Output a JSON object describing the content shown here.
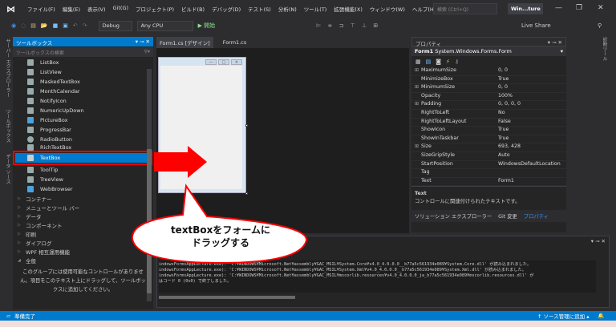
{
  "titlebar": {
    "menu": [
      "ファイル(F)",
      "編集(E)",
      "表示(V)",
      "Git(G)",
      "プロジェクト(P)",
      "ビルド(B)",
      "デバッグ(D)",
      "テスト(S)",
      "分析(N)",
      "ツール(T)",
      "拡張機能(X)",
      "ウィンドウ(W)",
      "ヘルプ(H)"
    ],
    "search_placeholder": "検索 (Ctrl+Q)",
    "window_title": "Win...ture"
  },
  "toolbar": {
    "config": "Debug",
    "platform": "Any CPU",
    "start": "▶ 開始",
    "live_share": "Live Share"
  },
  "left_strip": [
    "サーバー エクスプローラー",
    "ツールボックス",
    "データ ソース"
  ],
  "right_strip": "診断ツール",
  "toolbox": {
    "title": "ツールボックス",
    "search_placeholder": "ツールボックスの検索",
    "items": [
      "ListBox",
      "ListView",
      "MaskedTextBox",
      "MonthCalendar",
      "NotifyIcon",
      "NumericUpDown",
      "PictureBox",
      "ProgressBar",
      "RadioButton",
      "RichTextBox",
      "TextBox",
      "ToolTip",
      "TreeView",
      "WebBrowser"
    ],
    "selected": "TextBox",
    "groups": [
      "コンテナー",
      "メニューとツール バー",
      "データ",
      "コンポーネント",
      "印刷",
      "ダイアログ",
      "WPF 相互運用機能",
      "全般"
    ],
    "empty_note": "このグループには使用可能なコントロールがありません。項目をこのテキスト上にドラッグして、ツールボックスに追加してください。"
  },
  "doc_tabs": [
    "Form1.cs [デザイン]",
    "Form1.cs"
  ],
  "properties": {
    "title": "プロパティ",
    "object": "Form1",
    "object_type": "System.Windows.Forms.Form",
    "rows": [
      {
        "k": "MaximumSize",
        "v": "0, 0",
        "ex": true
      },
      {
        "k": "MinimizeBox",
        "v": "True"
      },
      {
        "k": "MinimumSize",
        "v": "0, 0",
        "ex": true
      },
      {
        "k": "Opacity",
        "v": "100%"
      },
      {
        "k": "Padding",
        "v": "0, 0, 0, 0",
        "ex": true
      },
      {
        "k": "RightToLeft",
        "v": "No"
      },
      {
        "k": "RightToLeftLayout",
        "v": "False"
      },
      {
        "k": "ShowIcon",
        "v": "True"
      },
      {
        "k": "ShowInTaskbar",
        "v": "True"
      },
      {
        "k": "Size",
        "v": "693, 428",
        "ex": true
      },
      {
        "k": "SizeGripStyle",
        "v": "Auto"
      },
      {
        "k": "StartPosition",
        "v": "WindowsDefaultLocation"
      },
      {
        "k": "Tag",
        "v": ""
      },
      {
        "k": "Text",
        "v": "Form1"
      }
    ],
    "desc_title": "Text",
    "desc": "コントロールに関連付けられたテキストです。",
    "bottom_tabs": [
      "ソリューション エクスプローラー",
      "Git 変更",
      "プロパティ"
    ]
  },
  "output": {
    "lines": [
      "indowsFormsAppLecture.exe): 'C:¥WINDOWS¥Microsoft.Net¥assembly¥GAC_MSIL¥System.Core¥v4.0_4.0.0.0__b77a5c561934e089¥System.Core.dll' が読み込まれました。",
      "indowsFormsAppLecture.exe): 'C:¥WINDOWS¥Microsoft.Net¥assembly¥GAC_MSIL¥System.Xml¥v4.0_4.0.0.0__b77a5c561934e089¥System.Xml.dll' が読み込まれました。",
      "indowsFormsAppLecture.exe): 'C:¥WINDOWS¥Microsoft.Net¥assembly¥GAC_MSIL¥mscorlib.resources¥v4.0_4.0.0.0_ja_b77a5c561934e089¥mscorlib.resources.dll' が",
      "はコード 0 (0x0) で終了しました。"
    ]
  },
  "status": {
    "ready": "準備完了",
    "source_control": "↑ ソース管理に追加 ▴"
  },
  "annotation": {
    "line1": "textBoxをフォームに",
    "line2": "ドラッグする",
    "color": "#ff0000"
  }
}
